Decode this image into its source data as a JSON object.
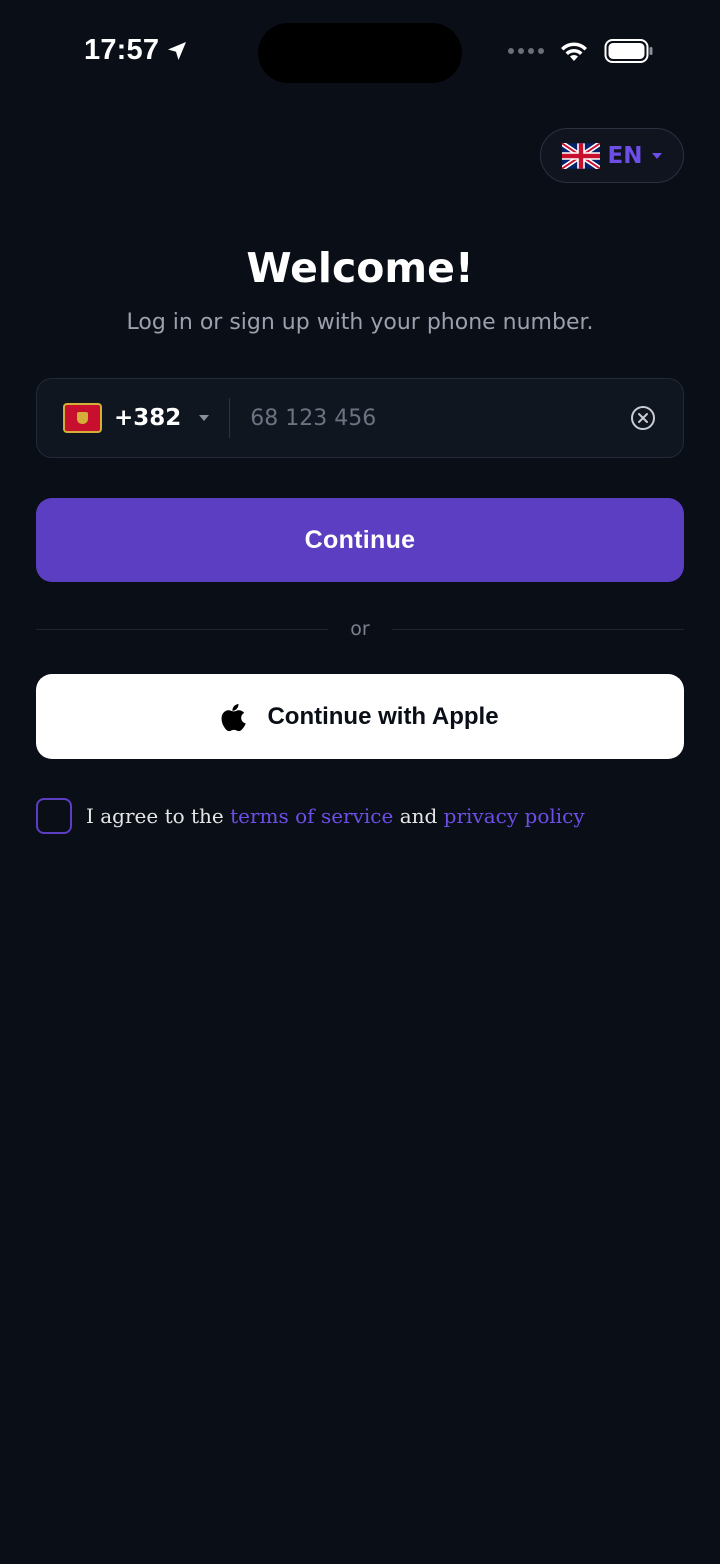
{
  "status_bar": {
    "time": "17:57"
  },
  "language": {
    "code": "EN",
    "flag_icon": "uk-flag-icon"
  },
  "header": {
    "title": "Welcome!",
    "subtitle": "Log in or sign up with your phone number."
  },
  "phone": {
    "country_flag_icon": "montenegro-flag-icon",
    "dial_code": "+382",
    "placeholder": "68 123 456",
    "value": ""
  },
  "actions": {
    "continue_label": "Continue",
    "or_label": "or",
    "apple_label": "Continue with Apple"
  },
  "terms": {
    "prefix": "I agree to the",
    "tos_label": "terms of service",
    "and": "and",
    "privacy_label": "privacy policy"
  },
  "colors": {
    "background": "#0a0e17",
    "accent": "#5b3ec2",
    "link": "#6d4ee6"
  }
}
